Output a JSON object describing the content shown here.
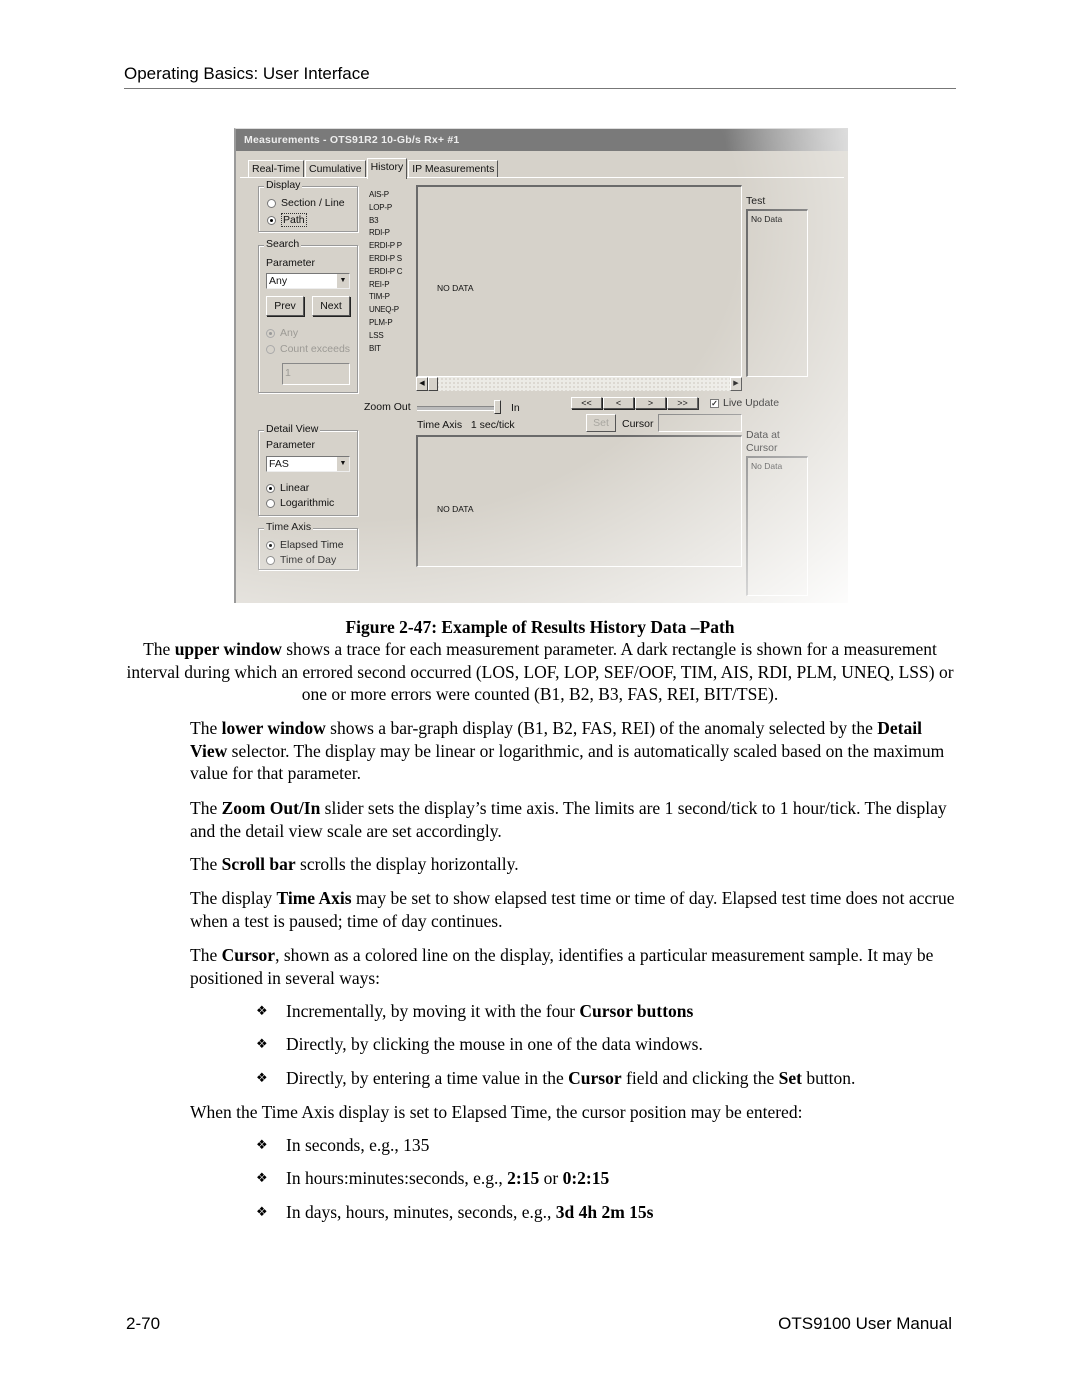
{
  "header": {
    "section": "Operating Basics: User Interface"
  },
  "window": {
    "title": "Measurements - OTS91R2 10-Gb/s Rx+ #1",
    "tabs": [
      {
        "label": "Real-Time",
        "active": false
      },
      {
        "label": "Cumulative",
        "active": false
      },
      {
        "label": "History",
        "active": true
      },
      {
        "label": "IP Measurements",
        "active": false
      }
    ],
    "display_group": {
      "label": "Display",
      "options": [
        {
          "label": "Section / Line",
          "selected": false
        },
        {
          "label": "Path",
          "selected": true
        }
      ]
    },
    "search_group": {
      "label": "Search",
      "parameter_label": "Parameter",
      "parameter_value": "Any",
      "prev_label": "Prev",
      "next_label": "Next",
      "options": [
        {
          "label": "Any",
          "selected": true
        },
        {
          "label": "Count exceeds",
          "selected": false
        }
      ],
      "count_value": "1"
    },
    "parameters": [
      "AIS-P",
      "LOP-P",
      "B3",
      "RDI-P",
      "ERDI-P P",
      "ERDI-P S",
      "ERDI-P C",
      "REI-P",
      "TIM-P",
      "UNEQ-P",
      "PLM-P",
      "LSS",
      "BIT"
    ],
    "upper_plot": {
      "message": "NO DATA"
    },
    "test_box": {
      "label": "Test",
      "value": "No Data"
    },
    "zoom": {
      "out_label": "Zoom Out",
      "in_label": "In",
      "value_fraction": 1.0
    },
    "time_axis_readout": {
      "label": "Time Axis",
      "value": "1 sec/tick"
    },
    "cursor_buttons": [
      "<<",
      "<",
      ">",
      ">>"
    ],
    "live_update": {
      "label": "Live Update",
      "checked": true
    },
    "set_label": "Set",
    "cursor_label": "Cursor",
    "cursor_value": "",
    "data_at_cursor": {
      "label_line1": "Data at",
      "label_line2": "Cursor",
      "value": "No Data"
    },
    "lower_plot": {
      "message": "NO DATA"
    },
    "detail_view": {
      "label": "Detail View",
      "parameter_label": "Parameter",
      "parameter_value": "FAS",
      "options": [
        {
          "label": "Linear",
          "selected": true
        },
        {
          "label": "Logarithmic",
          "selected": false
        }
      ]
    },
    "time_axis_group": {
      "label": "Time Axis",
      "options": [
        {
          "label": "Elapsed Time",
          "selected": true
        },
        {
          "label": "Time of Day",
          "selected": false
        }
      ]
    }
  },
  "caption": "Figure 2-47: Example of Results History Data –Path",
  "paragraphs": {
    "upper": {
      "pre": "The ",
      "bold": "upper window",
      "post": " shows a trace for each measurement parameter.  A dark rectangle is shown for a measurement interval during which an errored second occurred (LOS, LOF, LOP, SEF/OOF, TIM, AIS, RDI, PLM, UNEQ, LSS) or one or more errors were counted (B1, B2, B3, FAS, REI, BIT/TSE)."
    },
    "lower": {
      "pre": "The ",
      "bold1": "lower window",
      "mid": " shows a bar-graph display (B1, B2, FAS, REI) of the anomaly selected by the ",
      "bold2": "Detail View",
      "post": " selector.  The display may be linear or logarithmic, and is automatically scaled based on the maximum value for that parameter."
    },
    "zoom": {
      "pre": "The ",
      "bold": "Zoom Out/In",
      "post": " slider sets the display’s time axis.  The limits are 1 second/tick to 1 hour/tick.  The display and the detail view scale are set accordingly."
    },
    "scroll": {
      "pre": "The ",
      "bold": "Scroll bar",
      "post": " scrolls the display horizontally."
    },
    "timeaxis": {
      "pre": "The display ",
      "bold": "Time Axis",
      "post": " may be set to show elapsed test time or time of day.  Elapsed test time does not accrue when a test is paused; time of day continues."
    },
    "cursor": {
      "pre": "The ",
      "bold": "Cursor",
      "post": ", shown as a colored line on the display, identifies a particular measurement sample.  It may be positioned in several ways:"
    },
    "elapsed": "When the Time Axis display is set to Elapsed Time, the cursor position may be entered:"
  },
  "bullets_cursor": [
    {
      "pre": "Incrementally, by moving it with the four ",
      "bold": "Cursor buttons",
      "post": ""
    },
    {
      "pre": "Directly, by clicking the mouse in one of the data windows.",
      "bold": "",
      "post": ""
    },
    {
      "pre": "Directly, by entering a time value in the ",
      "bold": "Cursor",
      "post": " field and clicking the ",
      "bold2": "Set",
      "post2": " button."
    }
  ],
  "bullets_elapsed": [
    {
      "pre": "In seconds, e.g., 135",
      "bold": "",
      "mid": "",
      "bold2": ""
    },
    {
      "pre": "In hours:minutes:seconds, e.g., ",
      "bold": "2:15",
      "mid": " or ",
      "bold2": "0:2:15"
    },
    {
      "pre": "In days, hours, minutes, seconds, e.g., ",
      "bold": "3d 4h 2m 15s",
      "mid": "",
      "bold2": ""
    }
  ],
  "bullet_glyph": "❖",
  "footer": {
    "page": "2-70",
    "manual": "OTS9100 User Manual"
  }
}
